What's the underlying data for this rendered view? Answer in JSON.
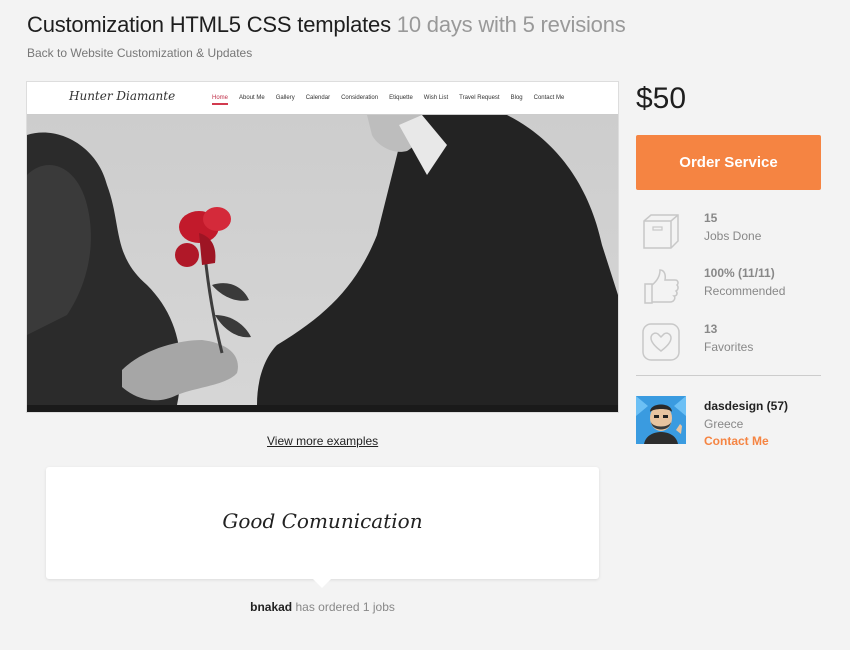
{
  "header": {
    "title": "Customization HTML5 CSS templates",
    "subtitle": "10 days with 5 revisions",
    "back_link": "Back to Website Customization & Updates"
  },
  "preview": {
    "logo": "Hunter Diamante",
    "menu": [
      "Home",
      "About Me",
      "Gallery",
      "Calendar",
      "Consideration",
      "Etiquette",
      "Wish List",
      "Travel Request",
      "Blog",
      "Contact Me"
    ],
    "view_more": "View more examples"
  },
  "testimonial": {
    "quote": "Good Comunication",
    "reviewer": "bnakad",
    "reviewer_note": "has ordered 1 jobs"
  },
  "sidebar": {
    "price": "$50",
    "order_button": "Order Service",
    "stats": [
      {
        "icon": "box-icon",
        "value": "15",
        "label": "Jobs Done"
      },
      {
        "icon": "thumbs-up-icon",
        "value": "100% (11/11)",
        "label": "Recommended"
      },
      {
        "icon": "heart-icon",
        "value": "13",
        "label": "Favorites"
      }
    ],
    "seller": {
      "name": "dasdesign (57)",
      "country": "Greece",
      "contact": "Contact Me"
    }
  },
  "colors": {
    "accent": "#f58442",
    "background": "#f3f3f3"
  }
}
